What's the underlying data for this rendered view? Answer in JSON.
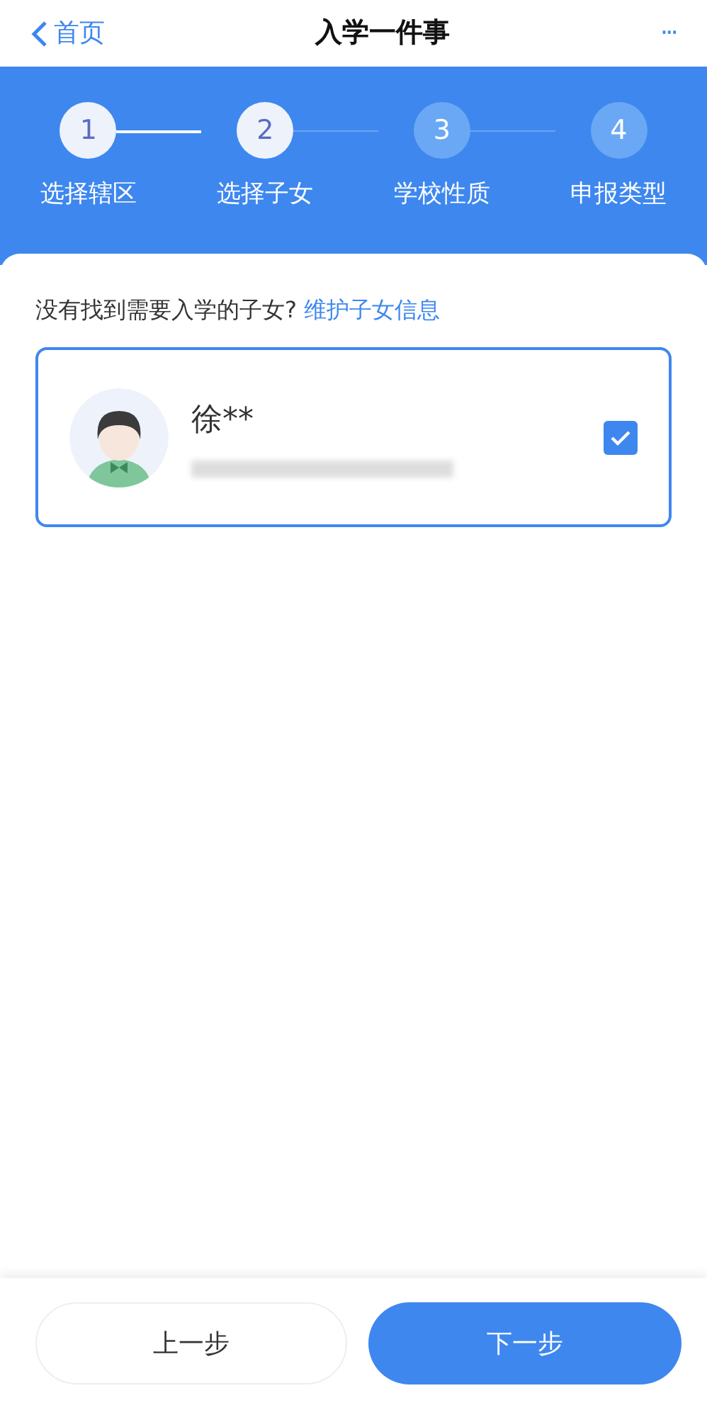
{
  "header": {
    "back": "首页",
    "title": "入学一件事",
    "more": "···"
  },
  "steps": [
    {
      "number": "1",
      "label": "选择辖区",
      "done": true
    },
    {
      "number": "2",
      "label": "选择子女",
      "done": true
    },
    {
      "number": "3",
      "label": "学校性质",
      "done": false
    },
    {
      "number": "4",
      "label": "申报类型",
      "done": false
    }
  ],
  "prompt": {
    "text": "没有找到需要入学的子女?",
    "link": "维护子女信息"
  },
  "children": [
    {
      "name": "徐**",
      "checked": true
    }
  ],
  "buttons": {
    "previous": "上一步",
    "next": "下一步"
  }
}
